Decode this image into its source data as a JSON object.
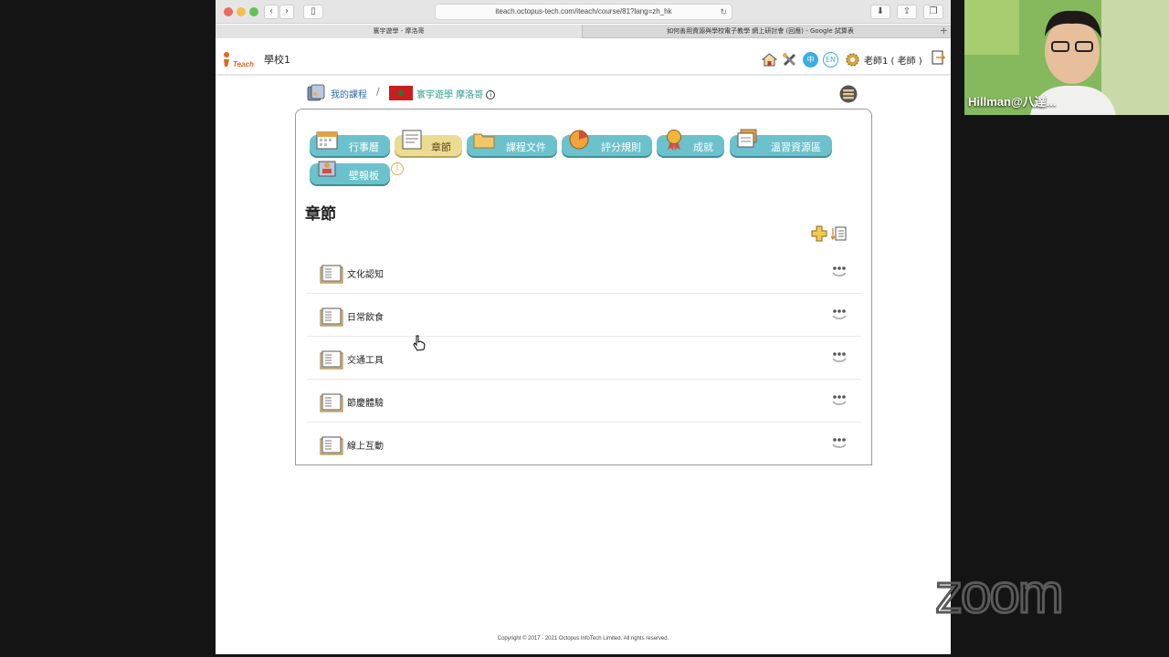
{
  "browser": {
    "url": "iteach.octopus-tech.com/iteach/course/81?lang=zh_hk",
    "tabs": [
      {
        "label": "寰宇遊學 - 摩洛哥"
      },
      {
        "label": "如何善用資源與學校電子教學 網上研討會 (回應) - Google 試算表"
      }
    ],
    "new_tab": "+"
  },
  "header": {
    "logo_text": "iTeach",
    "school": "學校1",
    "lang_zh": "中",
    "lang_en": "EN",
    "user": "老師1 ( 老師 )"
  },
  "breadcrumb": {
    "my_courses": "我的課程",
    "separator": "/",
    "course": "寰宇遊學 摩洛哥",
    "info": "i"
  },
  "tabs": [
    {
      "label": "行事曆",
      "icon": "calendar-icon"
    },
    {
      "label": "章節",
      "icon": "chapter-icon"
    },
    {
      "label": "課程文件",
      "icon": "folder-icon"
    },
    {
      "label": "評分規則",
      "icon": "pie-chart-icon"
    },
    {
      "label": "成就",
      "icon": "medal-icon"
    },
    {
      "label": "溫習資源區",
      "icon": "resources-icon"
    },
    {
      "label": "壁報板",
      "icon": "board-icon"
    }
  ],
  "tabs_info": "i",
  "section": {
    "title": "章節",
    "chapters": [
      {
        "label": "文化認知"
      },
      {
        "label": "日常飲食"
      },
      {
        "label": "交通工具"
      },
      {
        "label": "節慶體驗"
      },
      {
        "label": "線上互動"
      }
    ]
  },
  "footer": {
    "copyright": "Copyright © 2017 - 2021 Octopus InfoTech Limited. All rights reserved."
  },
  "video": {
    "participant": "Hillman@八達..."
  },
  "zoom_watermark": "zoom",
  "colors": {
    "tab": "#6cc2cc",
    "tab_active": "#ecdc92",
    "link_blue": "#2d6cb0",
    "course_teal": "#2a9a8d"
  }
}
